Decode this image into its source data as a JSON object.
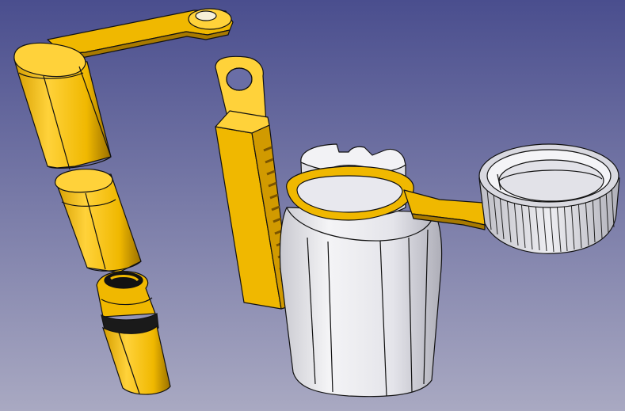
{
  "viewport": {
    "background_top": "#4a4e8e",
    "background_bottom": "#a9a9c2"
  },
  "colors": {
    "part_yellow": "#f0b800",
    "part_yellow_light": "#ffd23a",
    "part_yellow_dark": "#a87a00",
    "part_gray": "#e7e7ec",
    "part_gray_light": "#f6f6f8",
    "part_gray_dark": "#b4b4bc",
    "edge_black": "#111111",
    "cavity_black": "#121212"
  },
  "parts": [
    {
      "name": "hinge-arm",
      "material": "yellow"
    },
    {
      "name": "clip-bar",
      "material": "yellow"
    },
    {
      "name": "cylinder-segment-upper",
      "material": "yellow"
    },
    {
      "name": "cylinder-segment-middle",
      "material": "yellow"
    },
    {
      "name": "cylinder-segment-lower",
      "material": "yellow"
    },
    {
      "name": "bottle-body",
      "material": "gray"
    },
    {
      "name": "bottle-collar-strap",
      "material": "yellow"
    },
    {
      "name": "screw-cap",
      "material": "gray"
    }
  ]
}
